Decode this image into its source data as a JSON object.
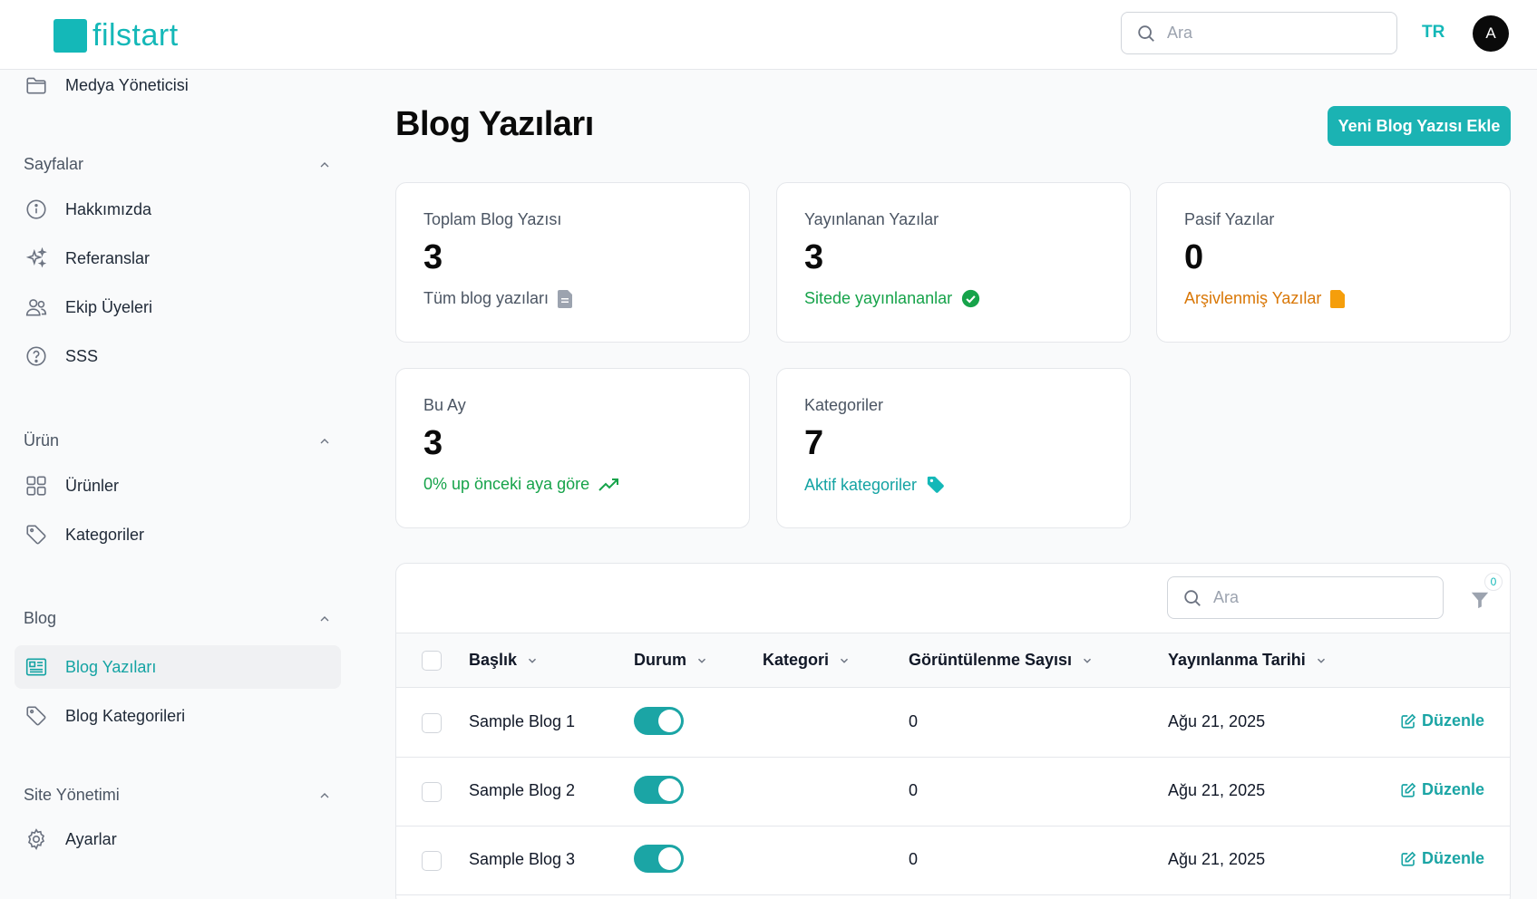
{
  "brand": {
    "name": "filstart",
    "color": "#14b8b8"
  },
  "header": {
    "search_placeholder": "Ara",
    "lang": "TR",
    "avatar_initial": "A"
  },
  "sidebar": {
    "top_item": {
      "label": "Medya Yöneticisi",
      "icon": "folder-icon"
    },
    "groups": [
      {
        "label": "Sayfalar",
        "items": [
          {
            "label": "Hakkımızda",
            "icon": "info-icon"
          },
          {
            "label": "Referanslar",
            "icon": "sparkles-icon"
          },
          {
            "label": "Ekip Üyeleri",
            "icon": "users-icon"
          },
          {
            "label": "SSS",
            "icon": "question-icon"
          }
        ]
      },
      {
        "label": "Ürün",
        "items": [
          {
            "label": "Ürünler",
            "icon": "grid-icon"
          },
          {
            "label": "Kategoriler",
            "icon": "tag-icon"
          }
        ]
      },
      {
        "label": "Blog",
        "items": [
          {
            "label": "Blog Yazıları",
            "icon": "newspaper-icon",
            "active": true
          },
          {
            "label": "Blog Kategorileri",
            "icon": "tag-icon"
          }
        ]
      },
      {
        "label": "Site Yönetimi",
        "items": [
          {
            "label": "Ayarlar",
            "icon": "gear-icon"
          }
        ]
      }
    ]
  },
  "main": {
    "title": "Blog Yazıları",
    "new_button": "Yeni Blog Yazısı Ekle",
    "stats": [
      {
        "label": "Toplam Blog Yazısı",
        "value": "3",
        "sub": "Tüm blog yazıları",
        "sub_color": "#4b5563",
        "icon": "document-icon"
      },
      {
        "label": "Yayınlanan Yazılar",
        "value": "3",
        "sub": "Sitede yayınlananlar",
        "sub_color": "#16a34a",
        "icon": "check-circle-icon"
      },
      {
        "label": "Pasif Yazılar",
        "value": "0",
        "sub": "Arşivlenmiş Yazılar",
        "sub_color": "#d97706",
        "icon": "document-icon"
      },
      {
        "label": "Bu Ay",
        "value": "3",
        "sub": "0% up önceki aya göre",
        "sub_color": "#16a34a",
        "icon": "trending-up-icon"
      },
      {
        "label": "Kategoriler",
        "value": "7",
        "sub": "Aktif kategoriler",
        "sub_color": "#14a3a3",
        "icon": "tag-icon"
      }
    ],
    "table": {
      "search_placeholder": "Ara",
      "filter_count": "0",
      "columns": [
        "Başlık",
        "Durum",
        "Kategori",
        "Görüntülenme Sayısı",
        "Yayınlanma Tarihi"
      ],
      "edit_label": "Düzenle",
      "rows": [
        {
          "title": "Sample Blog 1",
          "active": true,
          "category": "",
          "views": "0",
          "date": "Ağu 21, 2025"
        },
        {
          "title": "Sample Blog 2",
          "active": true,
          "category": "",
          "views": "0",
          "date": "Ağu 21, 2025"
        },
        {
          "title": "Sample Blog 3",
          "active": true,
          "category": "",
          "views": "0",
          "date": "Ağu 21, 2025"
        }
      ]
    }
  }
}
